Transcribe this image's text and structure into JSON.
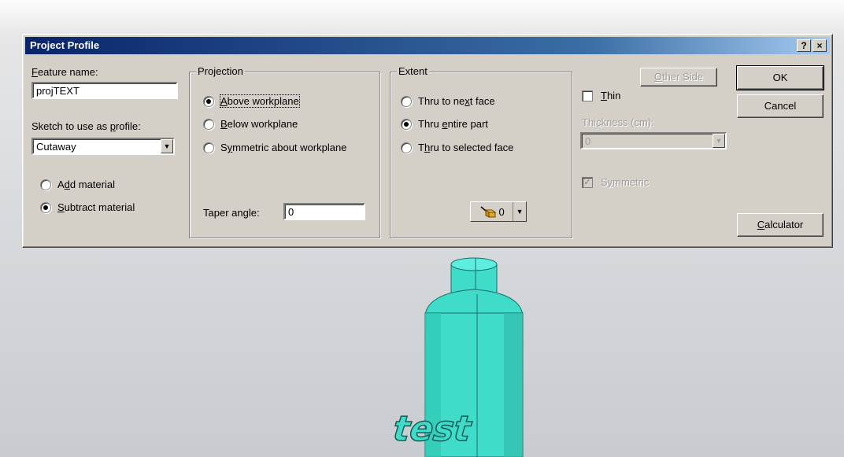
{
  "dialog": {
    "title": "Project Profile",
    "help_label": "?",
    "close_label": "×"
  },
  "feature": {
    "name_label": "Feature name:",
    "name_value": "projTEXT",
    "sketch_label": "Sketch to use as profile:",
    "sketch_value": "Cutaway"
  },
  "material": {
    "add_label": "Add material",
    "subtract_label": "Subtract material",
    "selected": "subtract"
  },
  "projection": {
    "title": "Projection",
    "above_label": "Above workplane",
    "below_label": "Below workplane",
    "symmetric_label": "Symmetric about workplane",
    "selected": "above",
    "taper_label": "Taper angle:",
    "taper_value": "0"
  },
  "extent": {
    "title": "Extent",
    "next_label": "Thru to next face",
    "entire_label": "Thru entire part",
    "selected_face_label": "Thru to selected face",
    "selected": "entire",
    "selector_value": "0"
  },
  "thin": {
    "other_side_label": "Other Side",
    "thin_label": "Thin",
    "thin_checked": false,
    "thickness_label": "Thickness (cm):",
    "thickness_value": "0",
    "symmetric_label": "Symmetric",
    "symmetric_checked": true
  },
  "buttons": {
    "ok_label": "OK",
    "cancel_label": "Cancel",
    "calculator_label": "Calculator"
  },
  "viewport": {
    "embossed_text": "test",
    "model_color": "#40e0d0"
  },
  "colors": {
    "title_bar": "#0a246a",
    "dialog_face": "#d4d0c8"
  }
}
